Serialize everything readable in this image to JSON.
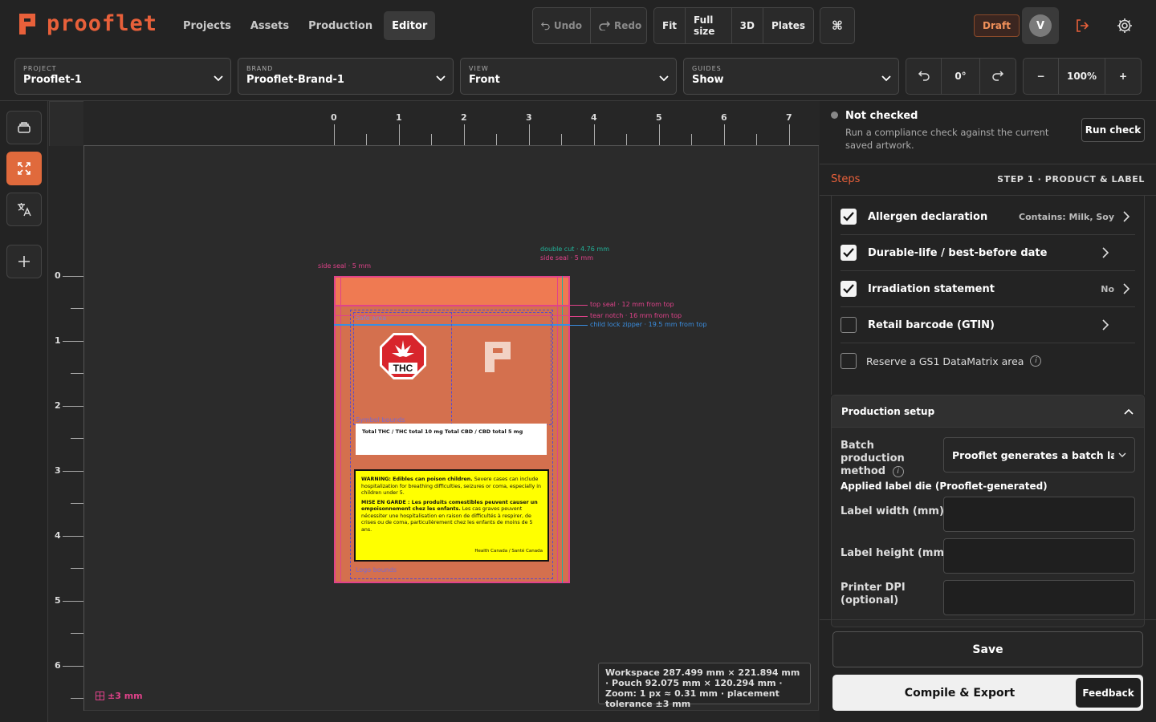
{
  "app": {
    "name": "prooflet",
    "accent": "#e8603a"
  },
  "nav": {
    "items": [
      {
        "label": "Projects"
      },
      {
        "label": "Assets"
      },
      {
        "label": "Production"
      },
      {
        "label": "Editor"
      }
    ]
  },
  "history": {
    "undo_label": "Undo",
    "redo_label": "Redo"
  },
  "view_controls": {
    "fit": "Fit",
    "full_size": "Full size",
    "three_d": "3D",
    "plates": "Plates",
    "command_glyph": "⌘"
  },
  "status": {
    "draft": "Draft"
  },
  "user": {
    "initial": "V"
  },
  "selectors": {
    "project": {
      "label": "PROJECT",
      "value": "Prooflet-1"
    },
    "brand": {
      "label": "BRAND",
      "value": "Prooflet-Brand-1"
    },
    "view": {
      "label": "VIEW",
      "value": "Front"
    },
    "guides": {
      "label": "GUIDES",
      "value": "Show"
    }
  },
  "rotation": {
    "value": "0°"
  },
  "zoom": {
    "minus": "−",
    "value": "100%",
    "plus": "+"
  },
  "rulers": {
    "horizontal": [
      "0",
      "1",
      "2",
      "3",
      "4",
      "5",
      "6",
      "7"
    ],
    "vertical": [
      "0",
      "1",
      "2",
      "3",
      "4",
      "5",
      "6"
    ]
  },
  "annotations": {
    "side_seal_left": "side seal · 5 mm",
    "double_cut": "double cut · 4.76 mm",
    "side_seal_right": "side seal · 5 mm",
    "top_seal": "top seal · 12 mm from top",
    "tear_notch": "tear notch · 16 mm from top",
    "child_lock": "child lock zipper · 19.5 mm from top",
    "safe_area": "Safe area",
    "symbol_bounds": "Symbol bounds",
    "logo_bounds": "Logo bounds"
  },
  "label": {
    "thc_symbol": "THC",
    "potency": "Total THC / THC total 10 mg Total CBD / CBD total 5 mg",
    "warning_en_bold": "WARNING: Edibles can poison children.",
    "warning_en": " Severe cases can include hospitalization for breathing difficulties, seizures or coma, especially in children under 5.",
    "warning_fr_bold": "MISE EN GARDE : Les produits comestibles peuvent causer un empoisonnement chez les enfants.",
    "warning_fr": " Les cas graves peuvent nécessiter une hospitalisation en raison de difficultés à respirer, de crises ou de coma, particulièrement chez les enfants de moins de 5 ans.",
    "warning_source": "Health Canada / Santé Canada"
  },
  "workspace_info": "Workspace 287.499 mm × 221.894 mm · Pouch 92.075 mm × 120.294 mm · Zoom: 1 px ≈ 0.31 mm · placement tolerance ±3 mm",
  "tolerance": "±3 mm",
  "compliance": {
    "status": "Not checked",
    "description": "Run a compliance check against the current saved artwork.",
    "run_button": "Run check"
  },
  "steps": {
    "title": "Steps",
    "current": "STEP 1 · PRODUCT & LABEL",
    "items": [
      {
        "label": "Allergen declaration",
        "value": "Contains: Milk, Soy",
        "checked": true
      },
      {
        "label": "Durable-life / best-before date",
        "value": "",
        "checked": true
      },
      {
        "label": "Irradiation statement",
        "value": "No",
        "checked": true
      },
      {
        "label": "Retail barcode (GTIN)",
        "value": "",
        "checked": false
      }
    ],
    "gs1": "Reserve a GS1 DataMatrix area"
  },
  "production": {
    "title": "Production setup",
    "batch_label": "Batch production method",
    "batch_value": "Prooflet generates a batch label t",
    "applied_die": "Applied label die (Prooflet-generated)",
    "label_width": "Label width (mm)",
    "label_height": "Label height (mm)",
    "printer_dpi": "Printer DPI (optional)"
  },
  "actions": {
    "save": "Save",
    "compile": "Compile & Export",
    "feedback": "Feedback"
  }
}
